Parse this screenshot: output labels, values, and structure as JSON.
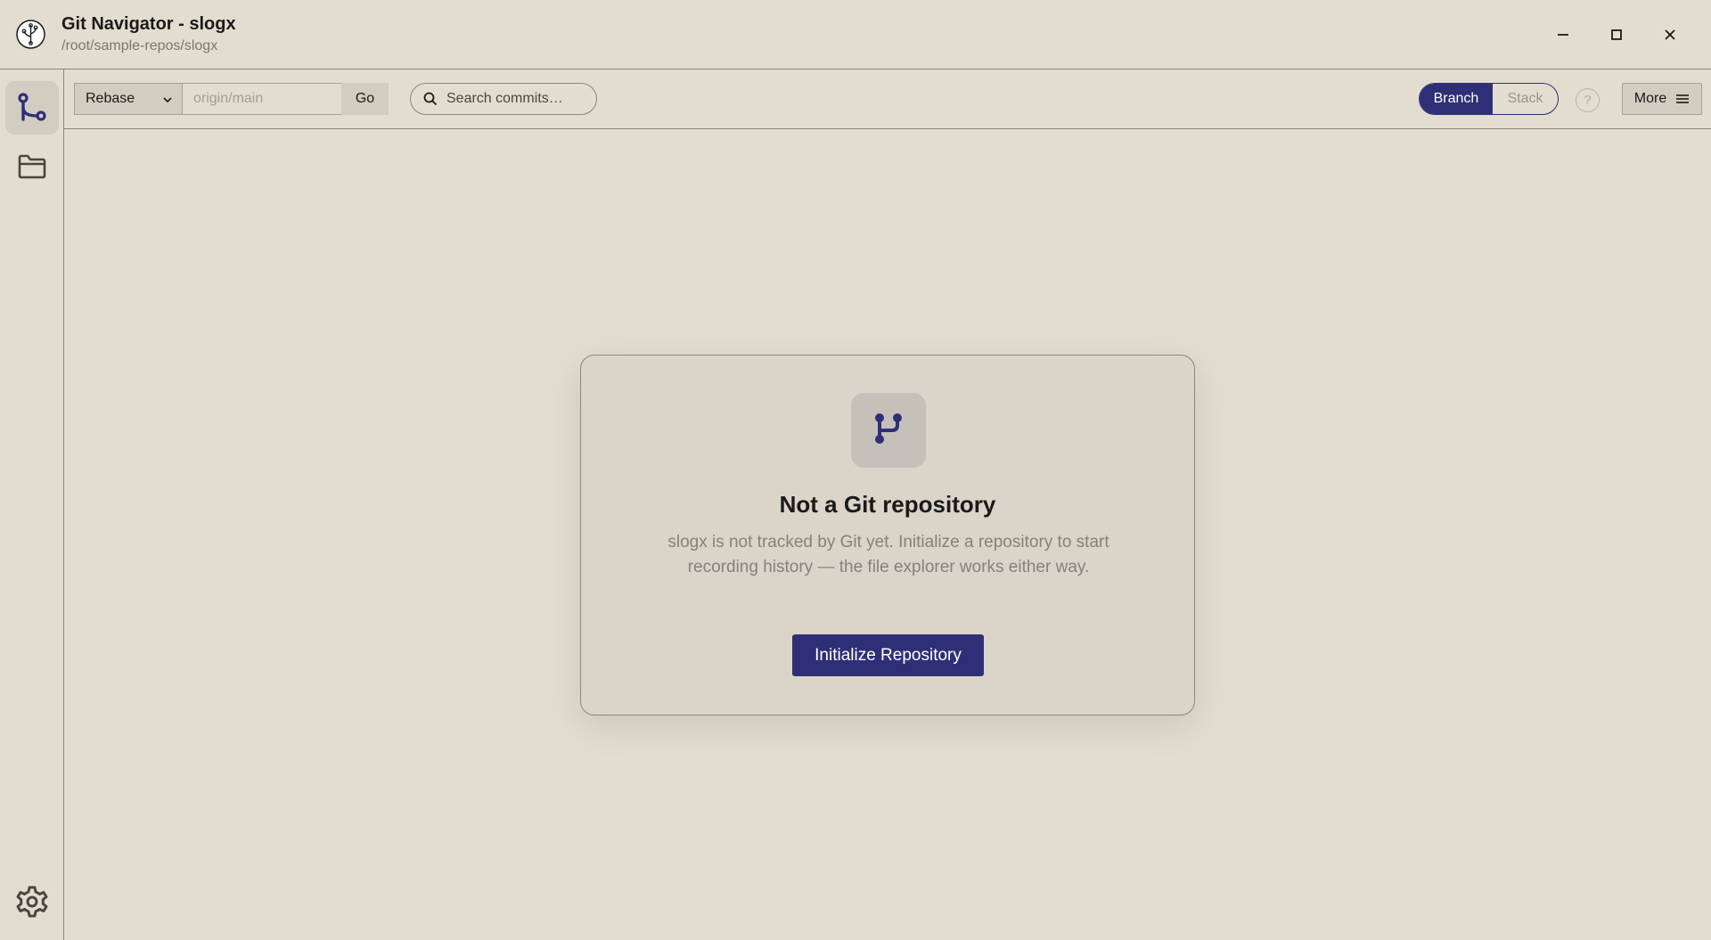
{
  "window": {
    "title": "Git Navigator - slogx",
    "path": "/root/sample-repos/slogx",
    "logo_icon": "git-navigator-logo-icon",
    "controls": [
      "minimize-icon",
      "maximize-icon",
      "close-icon"
    ]
  },
  "sidebar": {
    "items": [
      {
        "name": "branches",
        "icon": "git-branch-icon",
        "active": true
      },
      {
        "name": "files",
        "icon": "folder-icon",
        "active": false
      }
    ],
    "settings_icon": "gear-icon"
  },
  "toolbar": {
    "mode_select": {
      "value": "Rebase",
      "icon": "chevron-down-icon"
    },
    "ref_input": {
      "value": "",
      "placeholder": "origin/main"
    },
    "go_label": "Go",
    "search": {
      "placeholder": "Search commits…",
      "icon": "search-icon"
    },
    "view_toggle": {
      "options": [
        "Branch",
        "Stack"
      ],
      "selected": "Branch"
    },
    "help_label": "?",
    "more_label": "More",
    "more_icon": "hamburger-menu-icon"
  },
  "empty_state": {
    "icon": "git-branch-icon",
    "title": "Not a Git repository",
    "description": "slogx is not tracked by Git yet. Initialize a repository to start recording history — the file explorer works either way.",
    "button_label": "Initialize Repository"
  },
  "colors": {
    "background": "#e3ddd0",
    "accent": "#2f2f78",
    "card": "#dad4c9",
    "border": "#8d877c"
  }
}
